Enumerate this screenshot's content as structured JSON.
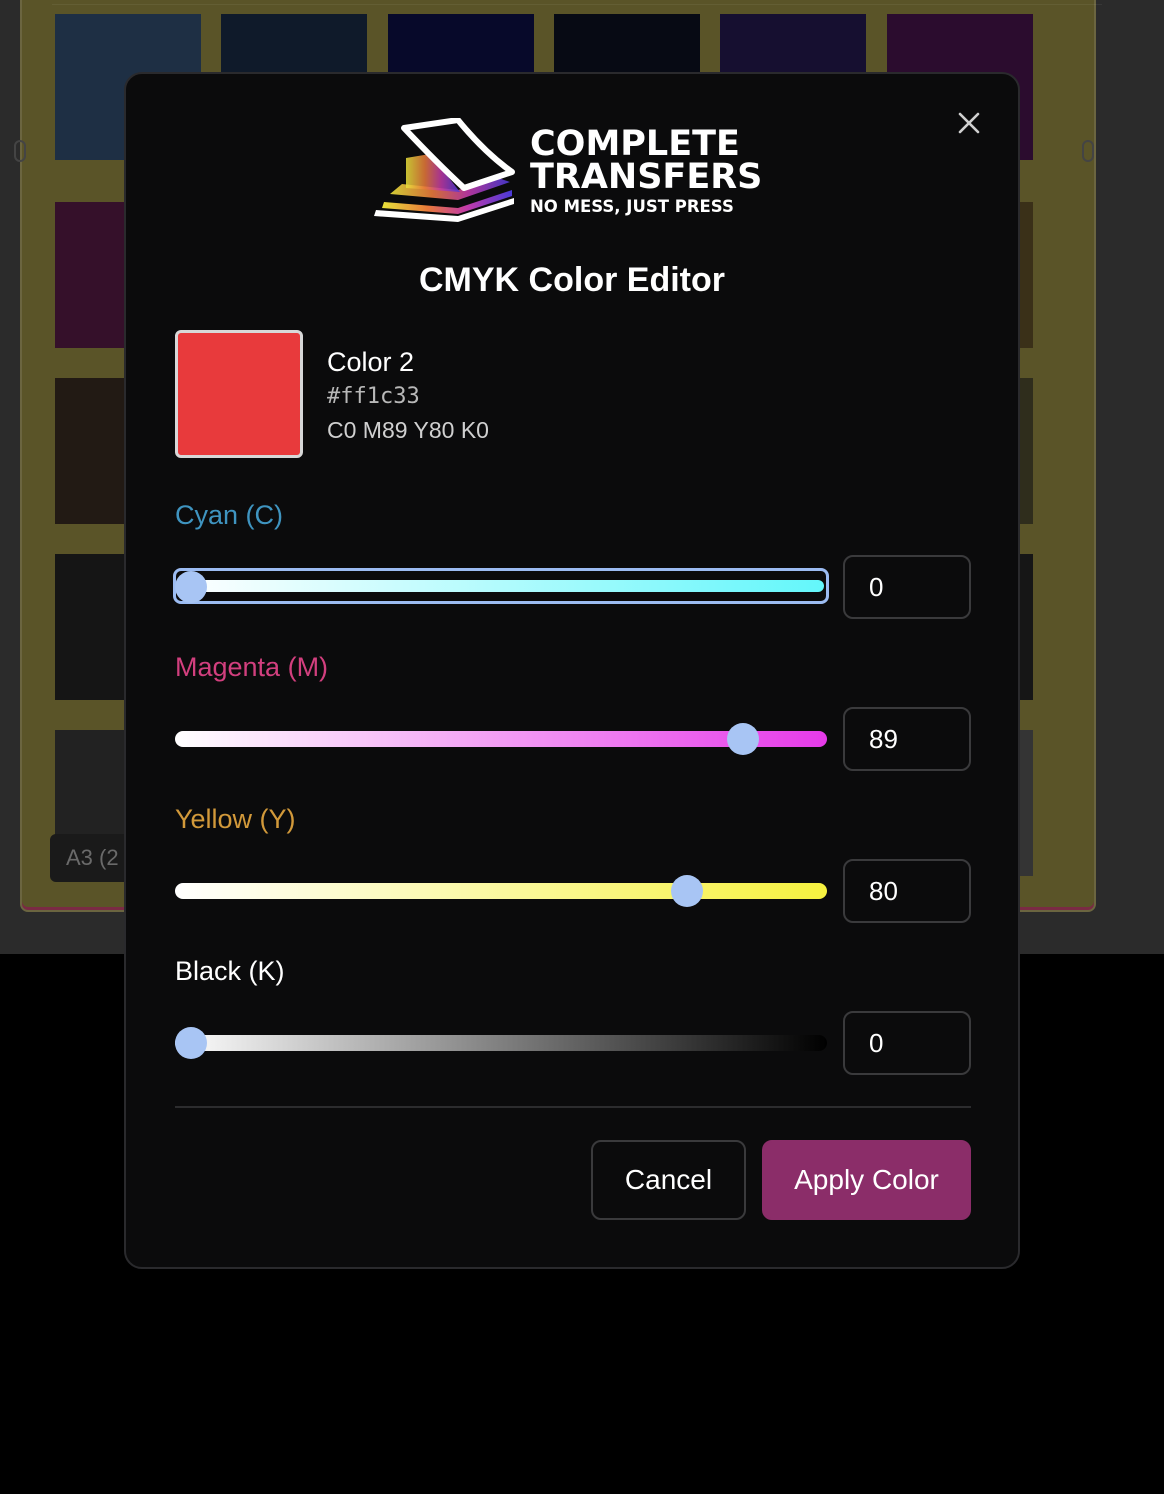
{
  "background": {
    "label": "A3 (2",
    "swatch_colors": [
      "#1e2f44",
      "#0f1a2a",
      "#07092a",
      "#070a14",
      "#160f30",
      "#2b0c2e",
      "#35102a",
      "#3a3018",
      "#221a14",
      "#2f2d1c",
      "#151515",
      "#161616",
      "#222222",
      "#343434",
      "#121212"
    ]
  },
  "modal": {
    "logo": {
      "line1": "COMPLETE",
      "line2": "TRANSFERS",
      "tagline": "NO MESS, JUST PRESS"
    },
    "title": "CMYK Color Editor",
    "close_icon": "close-icon",
    "preview": {
      "swatch_color": "#e83a3c",
      "name": "Color 2",
      "hex": "#ff1c33",
      "cmyk_summary": "C0 M89 Y80 K0"
    },
    "channels": [
      {
        "label": "Cyan (C)",
        "value": "0",
        "percent": 0,
        "label_color": "#3f94c0",
        "gradient_from": "#ffffff",
        "gradient_to": "#63f7fb",
        "focused": true
      },
      {
        "label": "Magenta (M)",
        "value": "89",
        "percent": 89,
        "label_color": "#d23f7e",
        "gradient_from": "#ffffff",
        "gradient_to": "#e63ae9",
        "focused": false
      },
      {
        "label": "Yellow (Y)",
        "value": "80",
        "percent": 80,
        "label_color": "#d2993a",
        "gradient_from": "#ffffff",
        "gradient_to": "#f6f23f",
        "focused": false
      },
      {
        "label": "Black (K)",
        "value": "0",
        "percent": 0,
        "label_color": "#ffffff",
        "gradient_from": "#ffffff",
        "gradient_to": "#000000",
        "focused": false
      }
    ],
    "buttons": {
      "cancel": "Cancel",
      "apply": "Apply Color"
    }
  }
}
